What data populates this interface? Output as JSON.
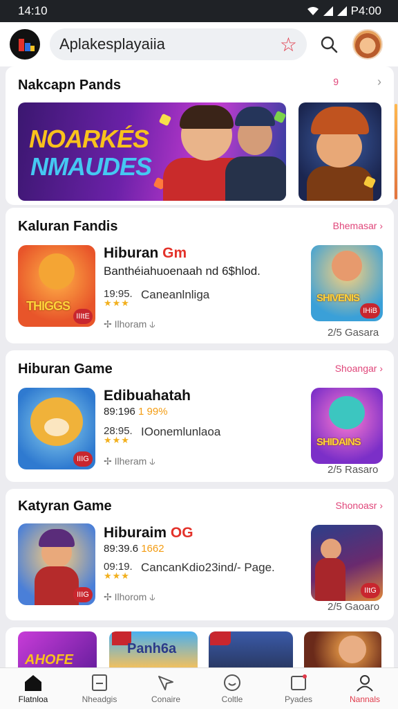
{
  "status_bar": {
    "time": "14:10",
    "right_text": "P4:00"
  },
  "app_bar": {
    "search_text": "Aplakesplayaiia"
  },
  "featured": {
    "title": "Nakcapn Pands",
    "banner_line1": "NOARKÉS",
    "banner_line2": "NMAUDES",
    "more": "›",
    "mark": "9"
  },
  "sections": [
    {
      "title": "Kaluran Fandis",
      "see_all": "Bhemasar ›",
      "app": {
        "title": "Hiburan ",
        "title_accent": "Gm",
        "subtitle": "Banthéiahuoenaah nd 6$hlod.",
        "subtitle_accent": "",
        "rating": "19:95.",
        "desc": "Caneanlnliga",
        "stars": "★★★",
        "meta": "Ilhoram"
      },
      "thumb_word": "THIGGS",
      "thumb_badge": "IIItE",
      "right_word": "SHIVENIS",
      "right_badge": "IHiB",
      "right_caption": "2/5 Gasara"
    },
    {
      "title": "Hiburan Game",
      "see_all": "Shoangar ›",
      "app": {
        "title": "Edibuahatah",
        "title_accent": "",
        "subtitle": "89:196 ",
        "subtitle_accent": "1 99%",
        "rating": "28:95.",
        "desc": "IOonemlunlaoa",
        "stars": "★★★",
        "meta": "Ilheram"
      },
      "thumb_word": "",
      "thumb_badge": "IIIG",
      "right_word": "SHIDAINS",
      "right_badge": "",
      "right_caption": "2/5 Rasaro"
    },
    {
      "title": "Katyran Game",
      "see_all": "Shonoasr ›",
      "app": {
        "title": "Hiburaim ",
        "title_accent": "OG",
        "subtitle": "89:39.6 ",
        "subtitle_accent": "1662",
        "rating": "09:19.",
        "desc": "CancanKdio23ind/- Page.",
        "stars": "★★★",
        "meta": "Ilhorom"
      },
      "thumb_word": "",
      "thumb_badge": "IIIG",
      "right_word": "",
      "right_badge": "IItG",
      "right_caption": "2/5 Gaoaro"
    }
  ],
  "bottom_strip": {
    "label2": "Panh6a",
    "label1": "AHOFE"
  },
  "bottom_nav": [
    {
      "label": "Flatnloa",
      "icon": "home-icon"
    },
    {
      "label": "Nheadgis",
      "icon": "document-icon"
    },
    {
      "label": "Conaire",
      "icon": "send-icon"
    },
    {
      "label": "Coltle",
      "icon": "clock-icon"
    },
    {
      "label": "Pyades",
      "icon": "inbox-icon"
    },
    {
      "label": "Nannals",
      "icon": "profile-icon"
    }
  ],
  "colors": {
    "accent": "#e0467a",
    "star": "#f2b01e",
    "badge": "#c8262e"
  }
}
